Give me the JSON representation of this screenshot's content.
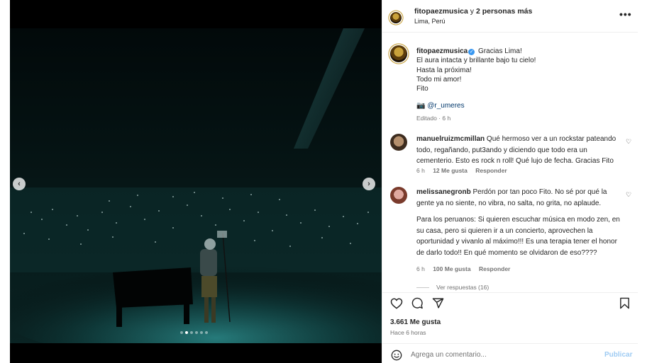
{
  "header": {
    "username": "fitopaezmusica",
    "conjunction": "y",
    "others": "2 personas más",
    "location": "Lima, Perú",
    "more_icon": "more-options-icon"
  },
  "caption": {
    "username": "fitopaezmusica",
    "first_line": "Gracias Lima!",
    "lines": [
      "El aura intacta y brillante bajo tu cielo!",
      "Hasta la próxima!",
      "Todo mi amor!",
      "Fito"
    ],
    "camera_emoji": "📷",
    "photo_credit": "@r_umeres",
    "edited": "Editado · 6 h"
  },
  "comments": [
    {
      "username": "manuelruizmcmillan",
      "text": "Qué hermoso ver a un rockstar pateando todo, regañando, put3ando y diciendo que todo era un cementerio. Esto es rock n roll! Qué lujo de fecha. Gracias Fito",
      "time": "6 h",
      "likes": "12 Me gusta",
      "reply": "Responder"
    },
    {
      "username": "melissanegronb",
      "text": "Perdón por tan poco Fito. No sé por qué la gente ya no siente, no vibra, no salta, no grita, no aplaude.",
      "text2": "Para los peruanos: Si quieren escuchar música en modo zen, en su casa, pero si quieren ir a un concierto, aprovechen la oportunidad y vivanlo al máximo!!! Es una terapia tener el honor de darlo todo!! En qué momento se olvidaron de eso????",
      "time": "6 h",
      "likes": "100 Me gusta",
      "reply": "Responder",
      "view_replies": "Ver respuestas (16)"
    }
  ],
  "post": {
    "likes": "3.661 Me gusta",
    "time": "Hace 6 horas"
  },
  "add_comment": {
    "placeholder": "Agrega un comentario...",
    "publish": "Publicar"
  },
  "carousel": {
    "prev": "‹",
    "next": "›",
    "slides_total": 6,
    "active_index": 1
  },
  "colors": {
    "verified": "#3897f0",
    "link": "#00376b",
    "publish_disabled": "#9ecbf3",
    "stage_light": "#1f6a6a"
  }
}
